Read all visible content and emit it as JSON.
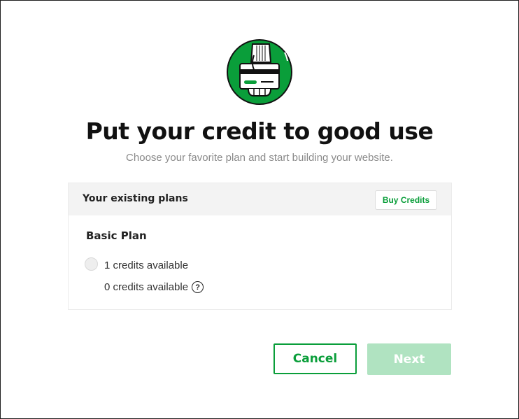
{
  "illustration": {
    "icon": "hand-holding-credit-card-icon",
    "accent": "#0a9e3a"
  },
  "dialog": {
    "title": "Put your credit to good use",
    "subtitle": "Choose your favorite plan and start building your website."
  },
  "plans": {
    "heading": "Your existing plans",
    "buy_credits_label": "Buy Credits",
    "items": [
      {
        "name": "Basic Plan",
        "selected": false,
        "credits_line_1": "1 credits available",
        "credits_line_2": "0 credits available",
        "help_icon": "question-circle-icon",
        "help_glyph": "?"
      }
    ]
  },
  "actions": {
    "cancel_label": "Cancel",
    "next_label": "Next",
    "next_enabled": false
  },
  "colors": {
    "primary_green": "#0a9e3a",
    "disabled_green": "#b0e3c1",
    "header_bg": "#f3f3f3"
  }
}
